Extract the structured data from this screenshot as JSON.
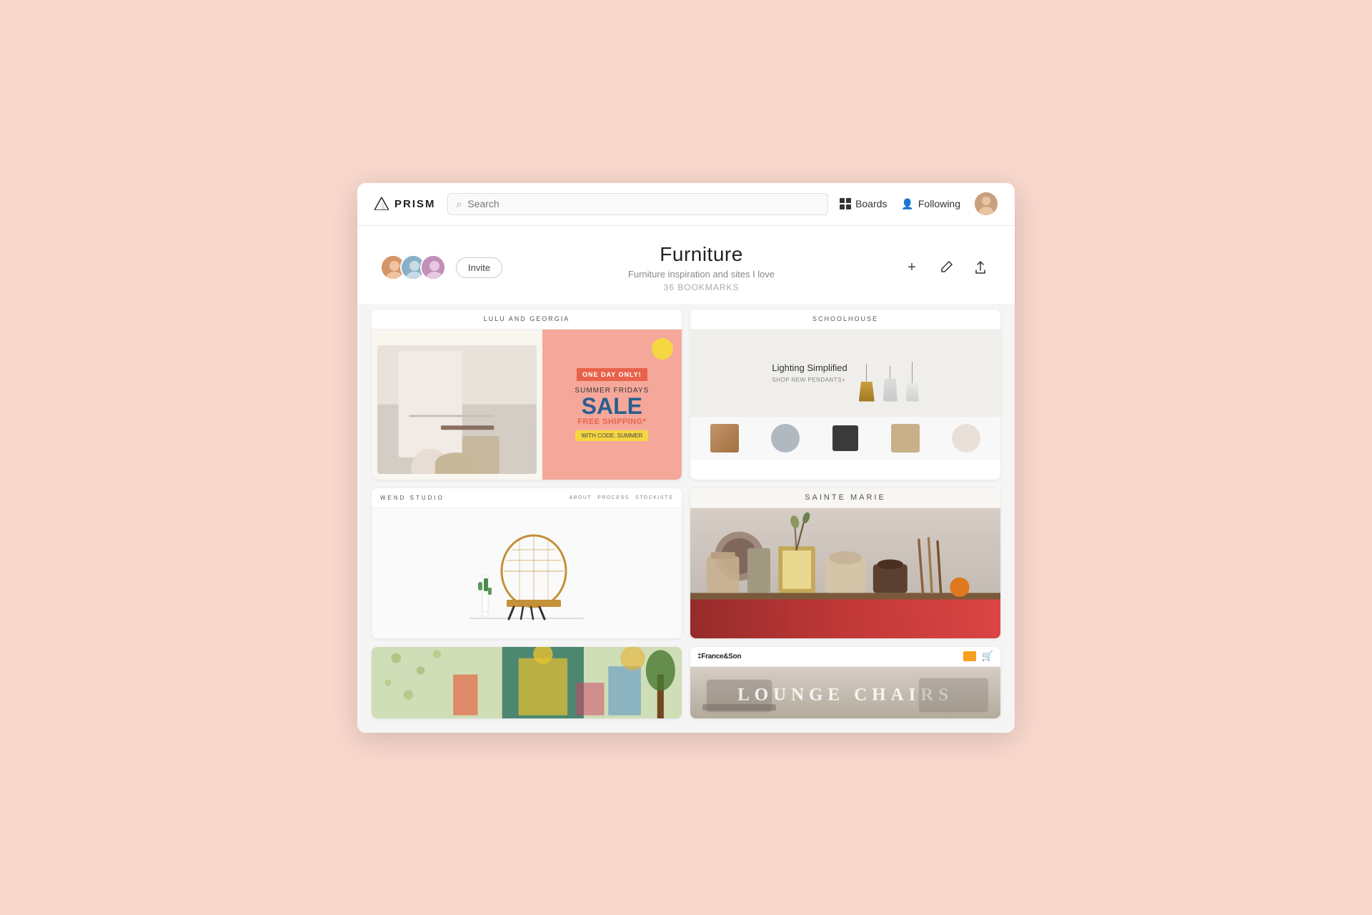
{
  "app": {
    "name": "PRISM"
  },
  "navbar": {
    "search_placeholder": "Search",
    "boards_label": "Boards",
    "following_label": "Following"
  },
  "board": {
    "title": "Furniture",
    "subtitle": "Furniture inspiration and sites I love",
    "bookmarks_count": "36 BOOKMARKS",
    "invite_label": "Invite"
  },
  "actions": {
    "add_label": "+",
    "edit_label": "✏",
    "share_label": "↑"
  },
  "cards": [
    {
      "id": "lulu-georgia",
      "site_name": "LULU AND GEORGIA",
      "type": "sale",
      "sale_badge": "ONE DAY ONLY!",
      "sale_line1": "SUMMER FRIDAYS",
      "sale_line2": "SALE",
      "sale_line3": "FREE SHIPPING*",
      "sale_code": "WITH CODE: SUMMER"
    },
    {
      "id": "schoolhouse",
      "site_name": "SCHOOLHOUSE",
      "tagline": "Lighting Simplified",
      "cta": "SHOP NEW PENDANTS+"
    },
    {
      "id": "wend-studio",
      "site_name": "WEND STUDIO",
      "nav_links": [
        "ABOUT",
        "PROCESS",
        "STOCKISTS"
      ]
    },
    {
      "id": "sainte-marie",
      "site_name": "SAINTE MARIE"
    },
    {
      "id": "colorful-room",
      "site_name": ""
    },
    {
      "id": "france-son",
      "site_name": "‡France&Son",
      "lounge_text": "LOUNGE CHAIRS"
    }
  ]
}
